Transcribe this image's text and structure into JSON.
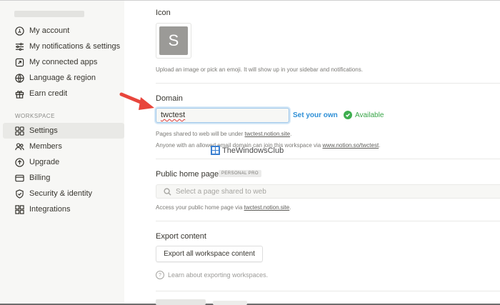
{
  "sidebar": {
    "items": [
      {
        "label": "My account",
        "icon": "account-circle-icon"
      },
      {
        "label": "My notifications & settings",
        "icon": "sliders-icon"
      },
      {
        "label": "My connected apps",
        "icon": "external-link-icon"
      },
      {
        "label": "Language & region",
        "icon": "globe-icon"
      },
      {
        "label": "Earn credit",
        "icon": "gift-icon"
      }
    ],
    "workspace_heading": "WORKSPACE",
    "workspace_items": [
      {
        "label": "Settings",
        "icon": "gear-icon",
        "active": true
      },
      {
        "label": "Members",
        "icon": "people-icon"
      },
      {
        "label": "Upgrade",
        "icon": "arrow-up-circle-icon"
      },
      {
        "label": "Billing",
        "icon": "card-icon"
      },
      {
        "label": "Security & identity",
        "icon": "shield-icon"
      },
      {
        "label": "Integrations",
        "icon": "grid-icon"
      }
    ]
  },
  "icon_section": {
    "label": "Icon",
    "avatar_letter": "S",
    "help": "Upload an image or pick an emoji. It will show up in your sidebar and notifications."
  },
  "domain_section": {
    "label": "Domain",
    "value": "twctest",
    "set_own": "Set your own",
    "available": "Available",
    "note1_prefix": "Pages shared to web will be under ",
    "note1_link": "twctest.notion.site",
    "note1_suffix": ".",
    "note2_prefix": "Anyone with an allowed email domain can join this workspace via ",
    "note2_link": "www.notion.so/twctest",
    "note2_suffix": "."
  },
  "watermark": {
    "text": "TheWindowsClub"
  },
  "home_page": {
    "label": "Public home page",
    "badge": "PERSONAL PRO",
    "placeholder": "Select a page shared to web",
    "note_prefix": "Access your public home page via ",
    "note_link": "twctest.notion.site",
    "note_suffix": "."
  },
  "export": {
    "label": "Export content",
    "button": "Export all workspace content",
    "help": "Learn about exporting workspaces."
  },
  "colors": {
    "accent": "#2e8fd6",
    "available": "#37a546",
    "arrow": "#e8453c"
  }
}
